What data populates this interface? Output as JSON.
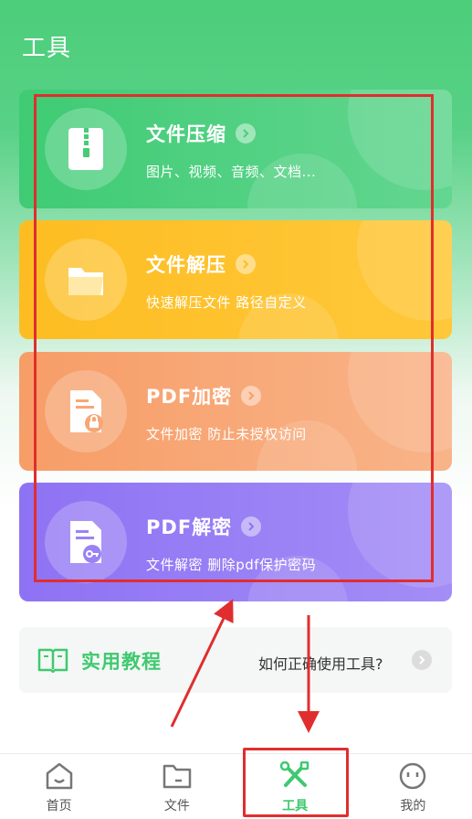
{
  "header": {
    "title": "工具"
  },
  "cards": [
    {
      "title": "文件压缩",
      "subtitle": "图片、视频、音频、文档...",
      "icon": "zip-file-icon",
      "color": "#3fcb74"
    },
    {
      "title": "文件解压",
      "subtitle": "快速解压文件 路径自定义",
      "icon": "folder-icon",
      "color": "#fdbd22"
    },
    {
      "title": "PDF加密",
      "subtitle": "文件加密 防止未授权访问",
      "icon": "file-lock-icon",
      "color": "#f79d67"
    },
    {
      "title": "PDF解密",
      "subtitle": "文件解密 删除pdf保护密码",
      "icon": "file-key-icon",
      "color": "#8e72f4"
    }
  ],
  "tutorial": {
    "title": "实用教程",
    "link": "如何正确使用工具?",
    "icon": "book-icon"
  },
  "tabbar": {
    "items": [
      {
        "label": "首页",
        "icon": "home-icon"
      },
      {
        "label": "文件",
        "icon": "folder-icon"
      },
      {
        "label": "工具",
        "icon": "tools-icon",
        "active": true
      },
      {
        "label": "我的",
        "icon": "profile-icon"
      }
    ]
  },
  "colors": {
    "accent": "#3ec96f",
    "annotation": "#e02e2e"
  }
}
